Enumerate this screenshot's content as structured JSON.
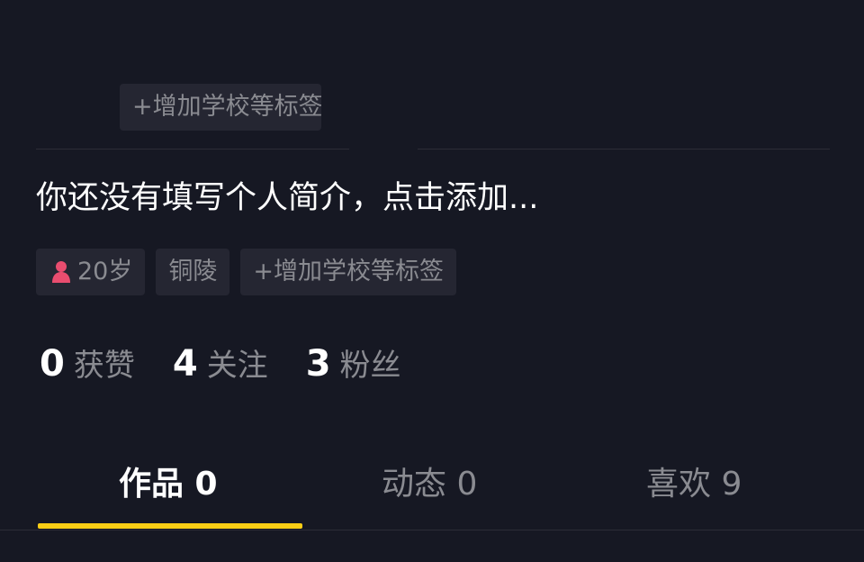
{
  "top_chip": {
    "label": "+增加学校等标签"
  },
  "bio": {
    "text": "你还没有填写个人简介，点击添加..."
  },
  "tags": [
    {
      "label": "20岁",
      "icon": "female-icon",
      "icon_color": "#e94d6f"
    },
    {
      "label": "铜陵"
    },
    {
      "label": "+增加学校等标签"
    }
  ],
  "stats": [
    {
      "value": "0",
      "label": "获赞"
    },
    {
      "value": "4",
      "label": "关注"
    },
    {
      "value": "3",
      "label": "粉丝"
    }
  ],
  "tabs": [
    {
      "label": "作品 0",
      "active": true
    },
    {
      "label": "动态 0",
      "active": false
    },
    {
      "label": "喜欢 9",
      "active": false
    }
  ],
  "colors": {
    "background": "#161823",
    "chip_bg": "#252632",
    "muted_text": "#8a8b91",
    "accent": "#face15"
  }
}
